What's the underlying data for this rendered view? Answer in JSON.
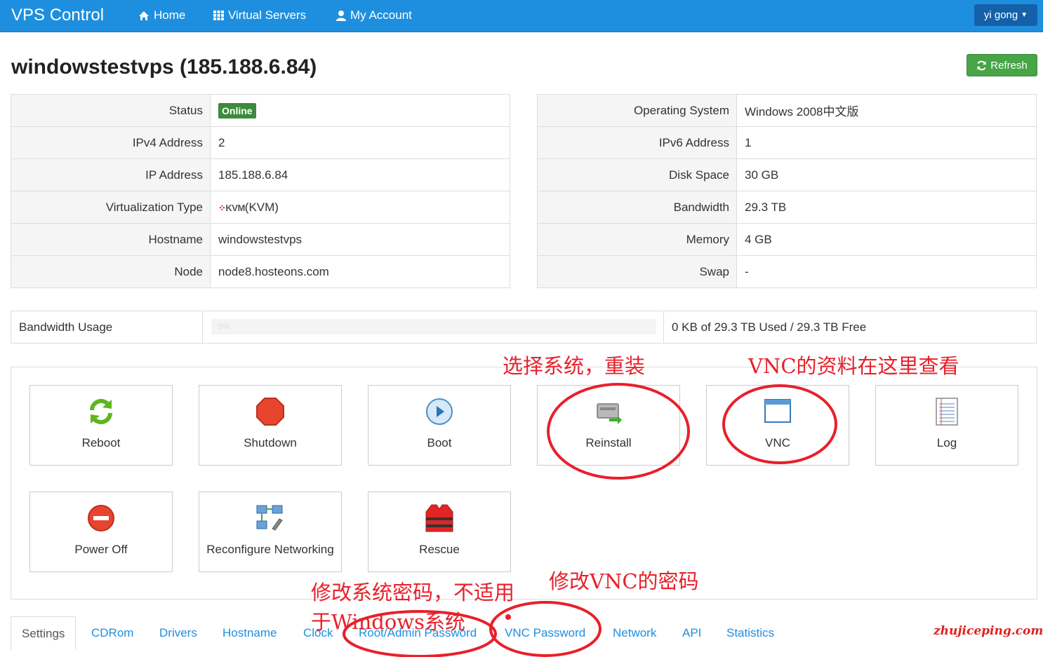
{
  "nav": {
    "brand": "VPS Control",
    "links": [
      "Home",
      "Virtual Servers",
      "My Account"
    ],
    "user": "yi gong"
  },
  "title": "windowstestvps (185.188.6.84)",
  "refresh_label": "Refresh",
  "left_table": [
    {
      "label": "Status",
      "value": "Online"
    },
    {
      "label": "IPv4 Address",
      "value": "2"
    },
    {
      "label": "IP Address",
      "value": "185.188.6.84"
    },
    {
      "label": "Virtualization Type",
      "value": "(KVM)",
      "logo": "KVM"
    },
    {
      "label": "Hostname",
      "value": "windowstestvps"
    },
    {
      "label": "Node",
      "value": "node8.hosteons.com"
    }
  ],
  "right_table": [
    {
      "label": "Operating System",
      "value": "Windows 2008中文版"
    },
    {
      "label": "IPv6 Address",
      "value": "1"
    },
    {
      "label": "Disk Space",
      "value": "30 GB"
    },
    {
      "label": "Bandwidth",
      "value": "29.3 TB"
    },
    {
      "label": "Memory",
      "value": "4 GB"
    },
    {
      "label": "Swap",
      "value": "-"
    }
  ],
  "bandwidth": {
    "label": "Bandwidth Usage",
    "percent_text": "0%",
    "usage": "0 KB of 29.3 TB Used / 29.3 TB Free"
  },
  "actions": [
    "Reboot",
    "Shutdown",
    "Boot",
    "Reinstall",
    "VNC",
    "Log",
    "Power Off",
    "Reconfigure Networking",
    "Rescue"
  ],
  "tabs": [
    "Settings",
    "CDRom",
    "Drivers",
    "Hostname",
    "Clock",
    "Root/Admin Password",
    "VNC Password",
    "Network",
    "API",
    "Statistics"
  ],
  "annotations": {
    "reinstall": "选择系统，重装",
    "vnc": "VNC的资料在这里查看",
    "root_pw_line1": "修改系统密码，不适用",
    "root_pw_line2": "于Windows系统",
    "vnc_pw": "修改VNC的密码"
  },
  "watermark": "zhujiceping.com",
  "colors": {
    "navbar": "#1e8fde",
    "online_badge": "#3c8b3c",
    "refresh_button": "#47a447",
    "annotation": "#e8202a"
  }
}
